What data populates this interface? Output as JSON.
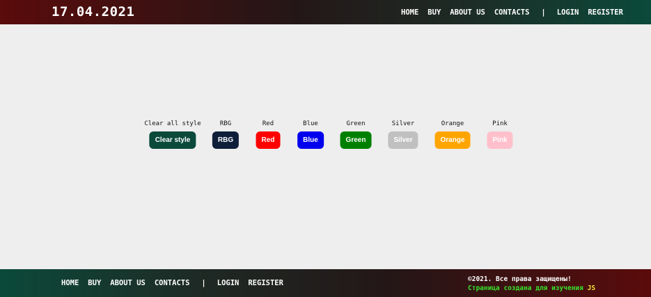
{
  "header": {
    "date": "17.04.2021",
    "nav": [
      "HOME",
      "BUY",
      "ABOUT US",
      "CONTACTS"
    ],
    "separator": "|",
    "auth": [
      "LOGIN",
      "REGISTER"
    ]
  },
  "buttons": [
    {
      "label": "Clear all style",
      "text": "Clear style",
      "color": "#0b4a3a"
    },
    {
      "label": "RBG",
      "text": "RBG",
      "color": "#0f1f3a"
    },
    {
      "label": "Red",
      "text": "Red",
      "color": "#ff0000"
    },
    {
      "label": "Blue",
      "text": "Blue",
      "color": "#0000ee"
    },
    {
      "label": "Green",
      "text": "Green",
      "color": "#008000"
    },
    {
      "label": "Silver",
      "text": "Silver",
      "color": "#c0c0c0"
    },
    {
      "label": "Orange",
      "text": "Orange",
      "color": "#ffa500"
    },
    {
      "label": "Pink",
      "text": "Pink",
      "color": "#ffc0cb"
    }
  ],
  "footer": {
    "nav": [
      "HOME",
      "BUY",
      "ABOUT US",
      "CONTACTS"
    ],
    "separator": "|",
    "auth": [
      "LOGIN",
      "REGISTER"
    ],
    "copyright": "©2021. Все права защищены!",
    "created": "Страница создана для изучения",
    "js": "JS"
  }
}
